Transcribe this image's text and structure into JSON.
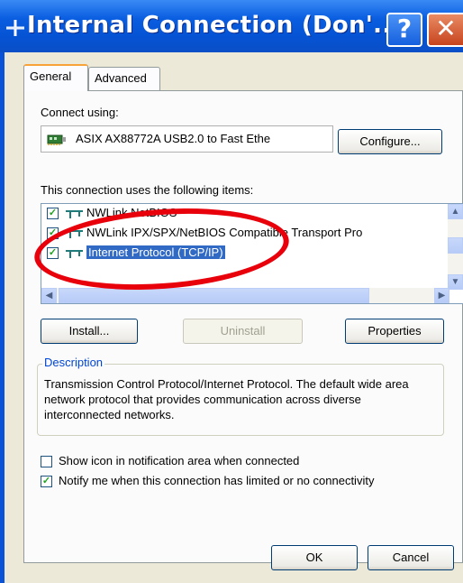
{
  "window": {
    "title": "Internal Connection (Don'...",
    "help_label": "?",
    "close_label": "✕"
  },
  "tabs": [
    {
      "label": "General",
      "active": true
    },
    {
      "label": "Advanced",
      "active": false
    }
  ],
  "connect_using": {
    "label": "Connect using:",
    "adapter_name": "ASIX AX88772A USB2.0 to Fast Ethe",
    "configure_label": "Configure..."
  },
  "items_section": {
    "label": "This connection uses the following items:",
    "items": [
      {
        "label": "NWLink NetBIOS",
        "checked": true,
        "selected": false
      },
      {
        "label": "NWLink IPX/SPX/NetBIOS Compatible Transport Pro",
        "checked": true,
        "selected": false
      },
      {
        "label": "Internet Protocol (TCP/IP)",
        "checked": true,
        "selected": true
      }
    ]
  },
  "buttons": {
    "install": "Install...",
    "uninstall": "Uninstall",
    "properties": "Properties",
    "ok": "OK",
    "cancel": "Cancel"
  },
  "description": {
    "legend": "Description",
    "text": "Transmission Control Protocol/Internet Protocol. The default wide area network protocol that provides communication across diverse interconnected networks."
  },
  "options": [
    {
      "label": "Show icon in notification area when connected",
      "checked": false
    },
    {
      "label": "Notify me when this connection has limited or no connectivity",
      "checked": true
    }
  ],
  "icons": {
    "title": "network-icon",
    "adapter": "network-card-icon",
    "protocol": "protocol-icon"
  },
  "colors": {
    "titlebar": "#0a5ee0",
    "selection": "#316ac5",
    "annotation_ellipse": "#e8000b",
    "tab_highlight": "#f7a33a"
  }
}
